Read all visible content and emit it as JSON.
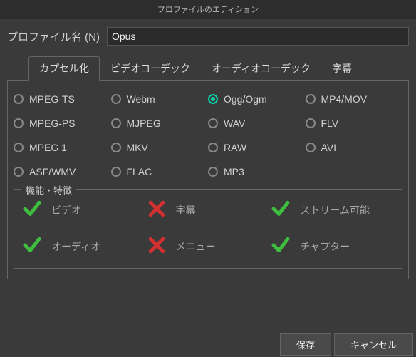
{
  "window": {
    "title": "プロファイルのエディション"
  },
  "profile": {
    "name_label": "プロファイル名 (N)",
    "name_value": "Opus"
  },
  "tabs": {
    "encapsulation": "カプセル化",
    "video_codec": "ビデオコーデック",
    "audio_codec": "オーディオコーデック",
    "subtitles": "字幕",
    "active": "encapsulation"
  },
  "formats": [
    {
      "id": "mpeg-ts",
      "label": "MPEG-TS",
      "selected": false
    },
    {
      "id": "webm",
      "label": "Webm",
      "selected": false
    },
    {
      "id": "ogg",
      "label": "Ogg/Ogm",
      "selected": true
    },
    {
      "id": "mp4",
      "label": "MP4/MOV",
      "selected": false
    },
    {
      "id": "mpeg-ps",
      "label": "MPEG-PS",
      "selected": false
    },
    {
      "id": "mjpeg",
      "label": "MJPEG",
      "selected": false
    },
    {
      "id": "wav",
      "label": "WAV",
      "selected": false
    },
    {
      "id": "flv",
      "label": "FLV",
      "selected": false
    },
    {
      "id": "mpeg1",
      "label": "MPEG 1",
      "selected": false
    },
    {
      "id": "mkv",
      "label": "MKV",
      "selected": false
    },
    {
      "id": "raw",
      "label": "RAW",
      "selected": false
    },
    {
      "id": "avi",
      "label": "AVI",
      "selected": false
    },
    {
      "id": "asf",
      "label": "ASF/WMV",
      "selected": false
    },
    {
      "id": "flac",
      "label": "FLAC",
      "selected": false
    },
    {
      "id": "mp3",
      "label": "MP3",
      "selected": false
    }
  ],
  "features": {
    "legend": "機能・特徴",
    "items": [
      {
        "id": "video",
        "label": "ビデオ",
        "supported": true
      },
      {
        "id": "subs",
        "label": "字幕",
        "supported": false
      },
      {
        "id": "stream",
        "label": "ストリーム可能",
        "supported": true
      },
      {
        "id": "audio",
        "label": "オーディオ",
        "supported": true
      },
      {
        "id": "menu",
        "label": "メニュー",
        "supported": false
      },
      {
        "id": "chapter",
        "label": "チャプター",
        "supported": true
      }
    ]
  },
  "buttons": {
    "save": "保存",
    "cancel": "キャンセル"
  },
  "colors": {
    "accent": "#00d4aa",
    "check": "#3fbf3f",
    "cross": "#d03030"
  }
}
